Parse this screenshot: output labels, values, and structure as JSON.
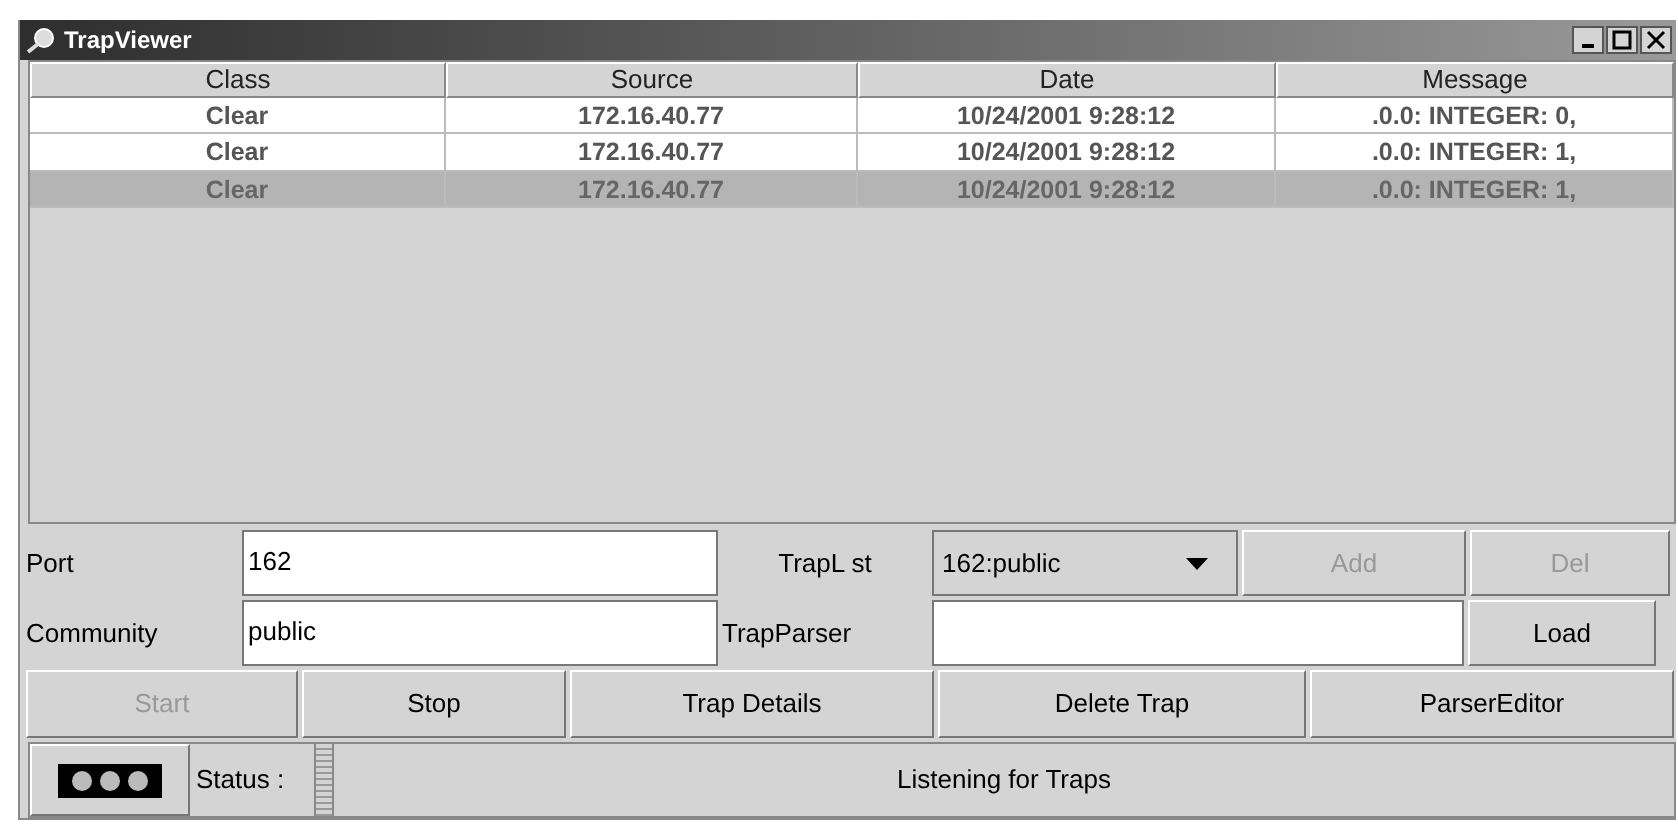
{
  "window": {
    "title": "TrapViewer"
  },
  "table": {
    "columns": [
      "Class",
      "Source",
      "Date",
      "Message"
    ],
    "rows": [
      {
        "cells": [
          "Clear",
          "172.16.40.77",
          "10/24/2001 9:28:12",
          ".0.0: INTEGER: 0,"
        ],
        "selected": false
      },
      {
        "cells": [
          "Clear",
          "172.16.40.77",
          "10/24/2001 9:28:12",
          ".0.0: INTEGER: 1,"
        ],
        "selected": false
      },
      {
        "cells": [
          "Clear",
          "172.16.40.77",
          "10/24/2001 9:28:12",
          ".0.0: INTEGER: 1,"
        ],
        "selected": true
      }
    ]
  },
  "form": {
    "port_label": "Port",
    "port_value": "162",
    "traplist_label": "TrapL st",
    "traplist_value": "162:public",
    "add_button": {
      "label": "Add",
      "disabled": true
    },
    "del_button": {
      "label": "Del",
      "disabled": true
    },
    "community_label": "Community",
    "community_value": "public",
    "trapparser_label": "TrapParser",
    "load_button": {
      "label": "Load",
      "disabled": false
    }
  },
  "buttons": [
    {
      "label": "Start",
      "disabled": true
    },
    {
      "label": "Stop",
      "disabled": false
    },
    {
      "label": "Trap Details",
      "disabled": false
    },
    {
      "label": "Delete Trap",
      "disabled": false
    },
    {
      "label": "ParserEditor",
      "disabled": false
    }
  ],
  "status_bar": {
    "label": "Status :",
    "message": "Listening for Traps"
  }
}
